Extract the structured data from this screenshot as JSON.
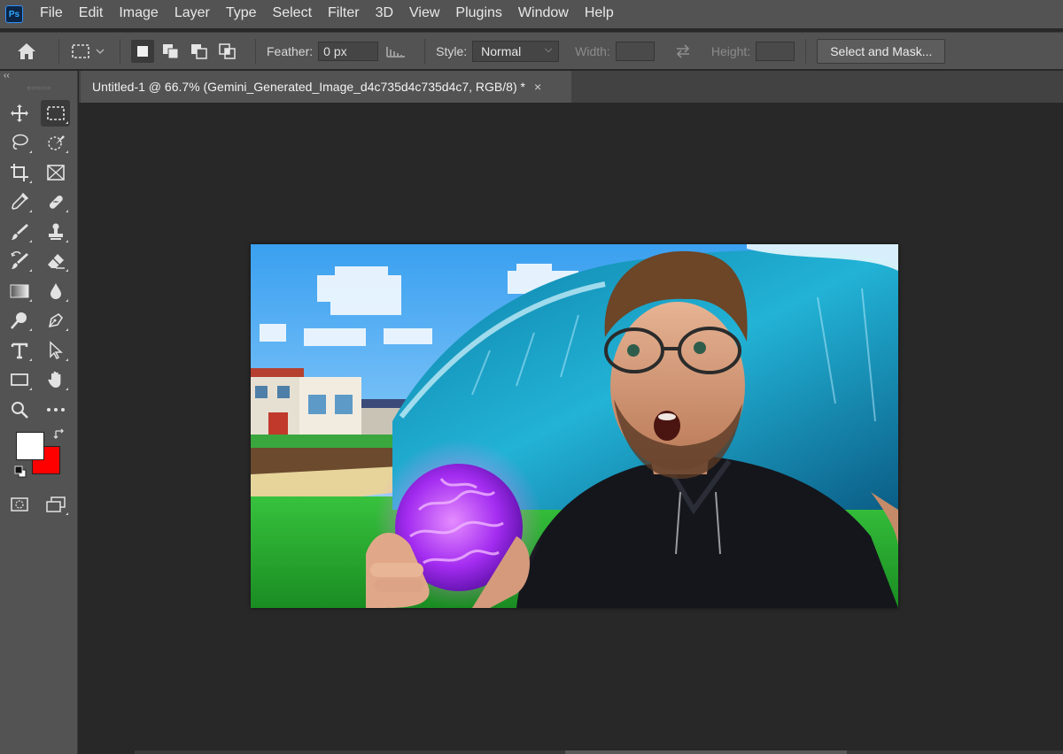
{
  "app": {
    "logo_text": "Ps",
    "menu": [
      "File",
      "Edit",
      "Image",
      "Layer",
      "Type",
      "Select",
      "Filter",
      "3D",
      "View",
      "Plugins",
      "Window",
      "Help"
    ]
  },
  "options": {
    "feather_label": "Feather:",
    "feather_value": "0 px",
    "style_label": "Style:",
    "style_value": "Normal",
    "width_label": "Width:",
    "height_label": "Height:",
    "select_mask_label": "Select and Mask..."
  },
  "toolbar": {
    "collapse_label": "‹‹",
    "foreground_color": "#ffffff",
    "background_color": "#ff0000"
  },
  "document": {
    "tab_title": "Untitled-1 @ 66.7% (Gemini_Generated_Image_d4c735d4c735d4c7, RGB/8) *",
    "close_glyph": "×"
  }
}
